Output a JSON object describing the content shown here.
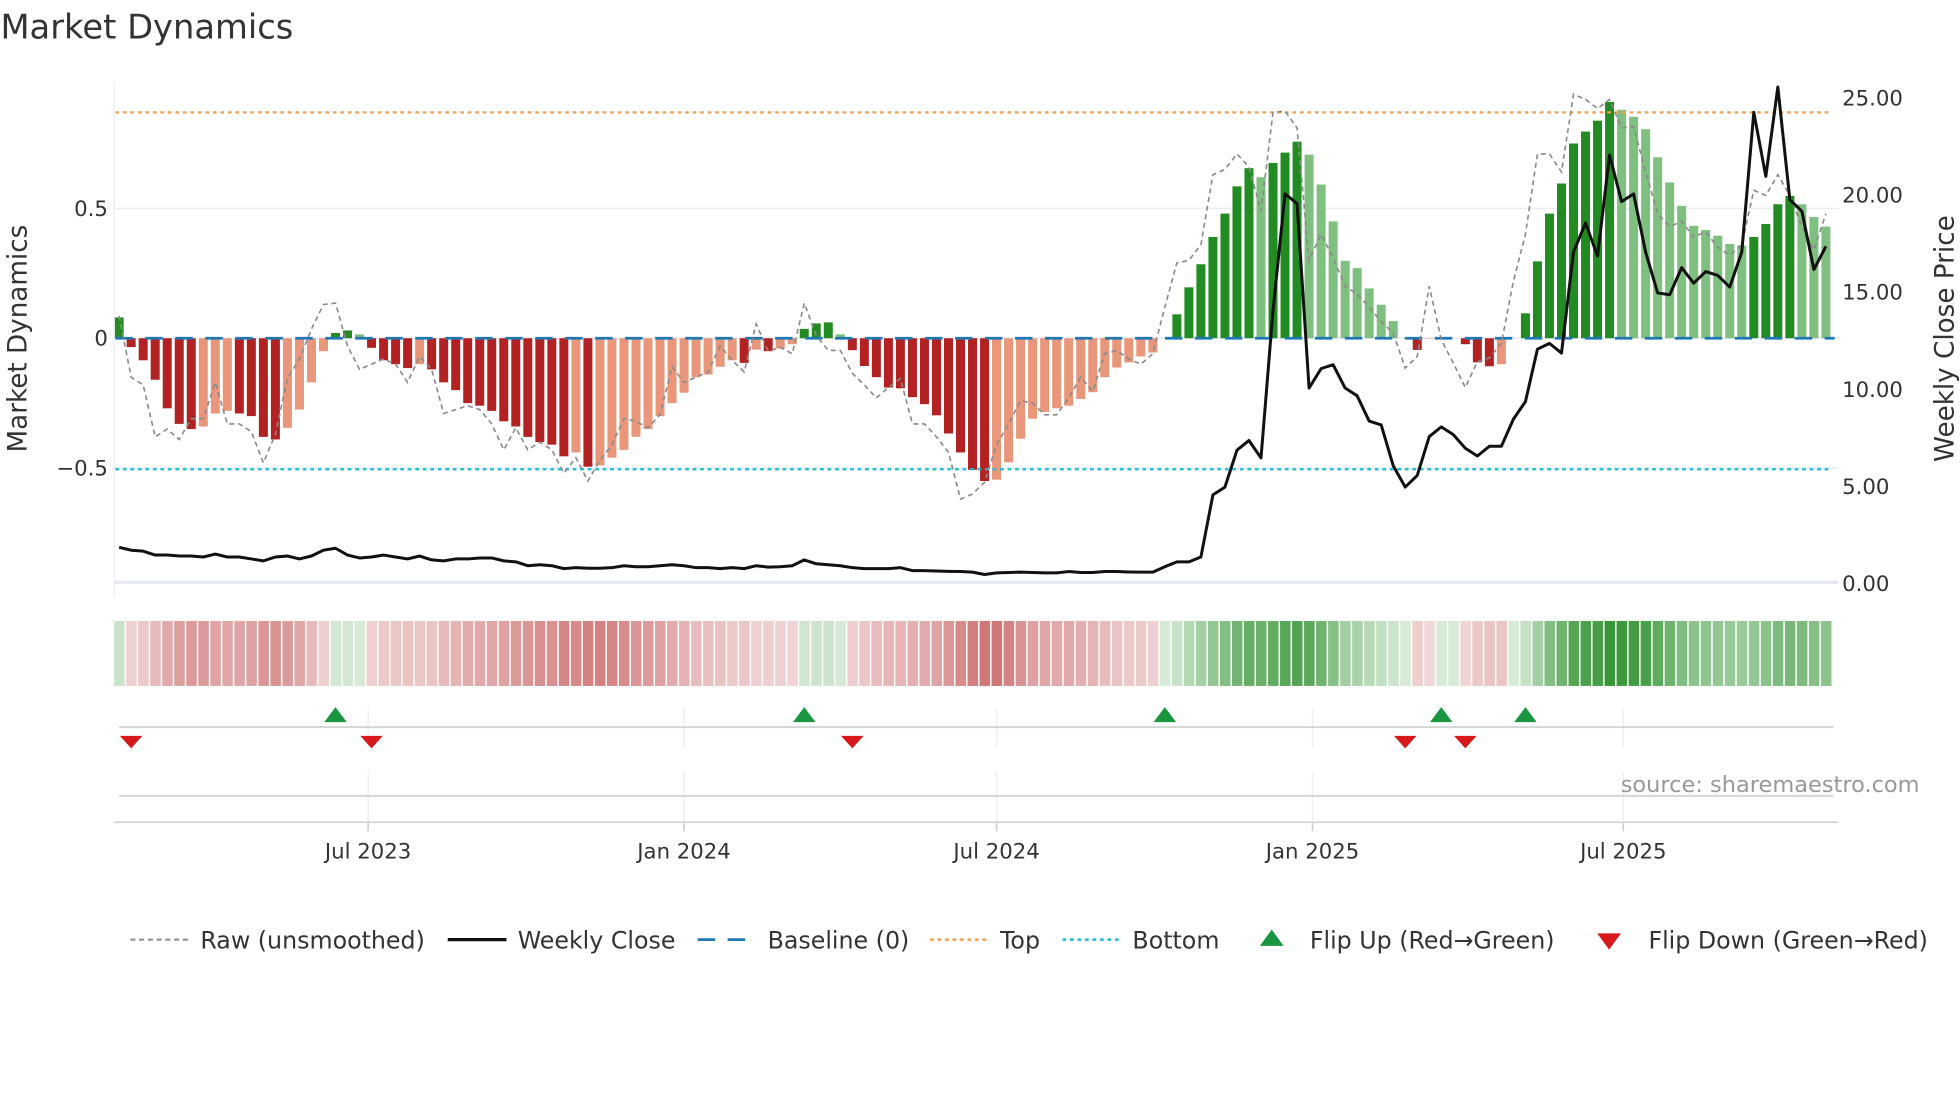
{
  "chart_data": {
    "type": "bar",
    "title": "Market Dynamics",
    "ylabel": "Market Dynamics",
    "y2label": "Weekly Close Price",
    "source": "source: sharemaestro.com",
    "x_start": "2023-02-06",
    "x_step": "weekly",
    "ylim": [
      -0.94,
      0.99
    ],
    "y2lim": [
      0,
      25.8
    ],
    "yticks": [
      {
        "v": 0.5,
        "label": "0.5"
      },
      {
        "v": 0,
        "label": "0"
      },
      {
        "v": -0.5,
        "label": "−0.5"
      }
    ],
    "y2ticks": [
      {
        "v": 25,
        "label": "25.00"
      },
      {
        "v": 20,
        "label": "20.00"
      },
      {
        "v": 15,
        "label": "15.00"
      },
      {
        "v": 10,
        "label": "10.00"
      },
      {
        "v": 5,
        "label": "5.00"
      },
      {
        "v": 0,
        "label": "0.00"
      }
    ],
    "xticks": [
      {
        "date": "2023-07-01",
        "label": "Jul 2023"
      },
      {
        "date": "2024-01-01",
        "label": "Jan 2024"
      },
      {
        "date": "2024-07-01",
        "label": "Jul 2024"
      },
      {
        "date": "2025-01-01",
        "label": "Jan 2025"
      },
      {
        "date": "2025-07-01",
        "label": "Jul 2025"
      }
    ],
    "top_level": 0.87,
    "bottom_level": -0.505,
    "baseline": 0,
    "colors": {
      "strong_green": "#228b22",
      "weak_green": "#7fbf7f",
      "strong_red": "#b22222",
      "weak_red": "#e9967a",
      "raw": "#8a8a8a",
      "close": "#111111",
      "baseline": "#1f77b4",
      "top": "#f0a050",
      "bottom": "#17becf",
      "flip_up": "#1a9641",
      "flip_down": "#d7191c"
    },
    "smoothed": [
      0.08,
      -0.034,
      -0.085,
      -0.16,
      -0.27,
      -0.33,
      -0.35,
      -0.34,
      -0.29,
      -0.28,
      -0.29,
      -0.3,
      -0.38,
      -0.39,
      -0.345,
      -0.275,
      -0.17,
      -0.05,
      0.02,
      0.03,
      0.015,
      -0.037,
      -0.085,
      -0.1,
      -0.115,
      -0.1,
      -0.12,
      -0.17,
      -0.2,
      -0.25,
      -0.26,
      -0.28,
      -0.32,
      -0.34,
      -0.38,
      -0.4,
      -0.41,
      -0.455,
      -0.44,
      -0.495,
      -0.49,
      -0.46,
      -0.43,
      -0.38,
      -0.35,
      -0.3,
      -0.25,
      -0.21,
      -0.15,
      -0.14,
      -0.11,
      -0.085,
      -0.095,
      -0.044,
      -0.05,
      -0.04,
      -0.023,
      0.036,
      0.057,
      0.061,
      0.015,
      -0.046,
      -0.107,
      -0.15,
      -0.19,
      -0.193,
      -0.227,
      -0.254,
      -0.297,
      -0.367,
      -0.44,
      -0.507,
      -0.55,
      -0.545,
      -0.478,
      -0.387,
      -0.31,
      -0.284,
      -0.27,
      -0.26,
      -0.234,
      -0.208,
      -0.15,
      -0.113,
      -0.093,
      -0.07,
      -0.055,
      0,
      0.092,
      0.196,
      0.285,
      0.39,
      0.48,
      0.585,
      0.655,
      0.62,
      0.675,
      0.715,
      0.757,
      0.707,
      0.592,
      0.45,
      0.298,
      0.27,
      0.192,
      0.129,
      0.066,
      0,
      -0.045,
      -0.002,
      0.003,
      0,
      -0.023,
      -0.093,
      -0.108,
      -0.1,
      0,
      0.096,
      0.296,
      0.48,
      0.596,
      0.75,
      0.796,
      0.838,
      0.91,
      0.88,
      0.853,
      0.805,
      0.697,
      0.6,
      0.51,
      0.433,
      0.417,
      0.395,
      0.363,
      0.357,
      0.39,
      0.44,
      0.516,
      0.548,
      0.516,
      0.467,
      0.43
    ],
    "raw": [
      0.086,
      -0.15,
      -0.18,
      -0.38,
      -0.35,
      -0.39,
      -0.31,
      -0.31,
      -0.17,
      -0.33,
      -0.33,
      -0.36,
      -0.48,
      -0.37,
      -0.155,
      -0.08,
      0.035,
      0.13,
      0.135,
      -0.03,
      -0.12,
      -0.1,
      -0.08,
      -0.1,
      -0.17,
      -0.07,
      -0.12,
      -0.29,
      -0.275,
      -0.26,
      -0.275,
      -0.33,
      -0.43,
      -0.345,
      -0.43,
      -0.4,
      -0.43,
      -0.52,
      -0.46,
      -0.55,
      -0.47,
      -0.41,
      -0.31,
      -0.32,
      -0.345,
      -0.295,
      -0.11,
      -0.17,
      -0.15,
      -0.13,
      -0.03,
      -0.085,
      -0.13,
      0.055,
      -0.05,
      -0.035,
      -0.06,
      0.135,
      0.01,
      -0.047,
      -0.047,
      -0.135,
      -0.18,
      -0.23,
      -0.19,
      -0.155,
      -0.33,
      -0.33,
      -0.38,
      -0.44,
      -0.62,
      -0.6,
      -0.555,
      -0.41,
      -0.33,
      -0.24,
      -0.25,
      -0.295,
      -0.295,
      -0.23,
      -0.15,
      -0.205,
      -0.06,
      -0.047,
      -0.08,
      -0.1,
      -0.06,
      0.12,
      0.29,
      0.3,
      0.36,
      0.63,
      0.65,
      0.71,
      0.66,
      0.49,
      0.87,
      0.875,
      0.81,
      0.3,
      0.4,
      0.31,
      0.2,
      0.17,
      0.12,
      0.064,
      0.02,
      -0.115,
      -0.07,
      0.2,
      -0.006,
      -0.096,
      -0.19,
      -0.09,
      -0.076,
      -0.02,
      0.22,
      0.4,
      0.71,
      0.71,
      0.64,
      0.94,
      0.92,
      0.885,
      0.92,
      0.81,
      0.815,
      0.64,
      0.48,
      0.43,
      0.45,
      0.39,
      0.41,
      0.35,
      0.32,
      0.36,
      0.57,
      0.55,
      0.63,
      0.55,
      0.43,
      0.34,
      0.48
    ],
    "close": [
      1.8,
      1.65,
      1.6,
      1.4,
      1.4,
      1.35,
      1.35,
      1.3,
      1.45,
      1.3,
      1.3,
      1.2,
      1.1,
      1.3,
      1.35,
      1.2,
      1.35,
      1.65,
      1.75,
      1.4,
      1.25,
      1.3,
      1.4,
      1.3,
      1.2,
      1.35,
      1.15,
      1.1,
      1.2,
      1.2,
      1.25,
      1.25,
      1.1,
      1.05,
      0.85,
      0.9,
      0.85,
      0.7,
      0.75,
      0.72,
      0.72,
      0.75,
      0.85,
      0.8,
      0.8,
      0.85,
      0.9,
      0.85,
      0.75,
      0.75,
      0.7,
      0.75,
      0.7,
      0.85,
      0.78,
      0.8,
      0.85,
      1.15,
      0.95,
      0.9,
      0.85,
      0.75,
      0.7,
      0.7,
      0.7,
      0.75,
      0.6,
      0.6,
      0.58,
      0.56,
      0.55,
      0.52,
      0.4,
      0.48,
      0.5,
      0.52,
      0.5,
      0.48,
      0.48,
      0.55,
      0.5,
      0.5,
      0.55,
      0.55,
      0.53,
      0.52,
      0.52,
      0.8,
      1.05,
      1.05,
      1.3,
      4.5,
      4.9,
      6.8,
      7.3,
      6.4,
      14,
      20.0,
      19.5,
      10.0,
      11.0,
      11.2,
      10.0,
      9.6,
      8.3,
      8.1,
      6.0,
      4.9,
      5.5,
      7.5,
      8.0,
      7.6,
      6.9,
      6.5,
      7.0,
      7.0,
      8.4,
      9.3,
      12.0,
      12.3,
      11.8,
      17.0,
      18.5,
      16.8,
      22.0,
      19.6,
      20.0,
      17.0,
      14.9,
      14.8,
      16.2,
      15.4,
      16.0,
      15.8,
      15.2,
      17.0,
      24.2,
      20.9,
      25.5,
      19.7,
      19.1,
      16.1,
      17.3
    ],
    "flip_up_dates": [
      "2023-06-12",
      "2024-03-11",
      "2024-10-07",
      "2025-03-17",
      "2025-05-05"
    ],
    "flip_down_dates": [
      "2023-02-13",
      "2023-07-03",
      "2024-04-08",
      "2025-02-24",
      "2025-03-31"
    ],
    "legend": {
      "position": "bottom",
      "items": [
        {
          "label": "Raw (unsmoothed)",
          "icon": "dashed-gray-line"
        },
        {
          "label": "Weekly Close",
          "icon": "solid-black-line"
        },
        {
          "label": "Baseline (0)",
          "icon": "dashed-blue-line"
        },
        {
          "label": "Top",
          "icon": "dotted-orange-line"
        },
        {
          "label": "Bottom",
          "icon": "dotted-cyan-line"
        },
        {
          "label": "Flip Up (Red→Green)",
          "icon": "green-up-triangle"
        },
        {
          "label": "Flip Down (Green→Red)",
          "icon": "red-down-triangle"
        }
      ]
    }
  }
}
